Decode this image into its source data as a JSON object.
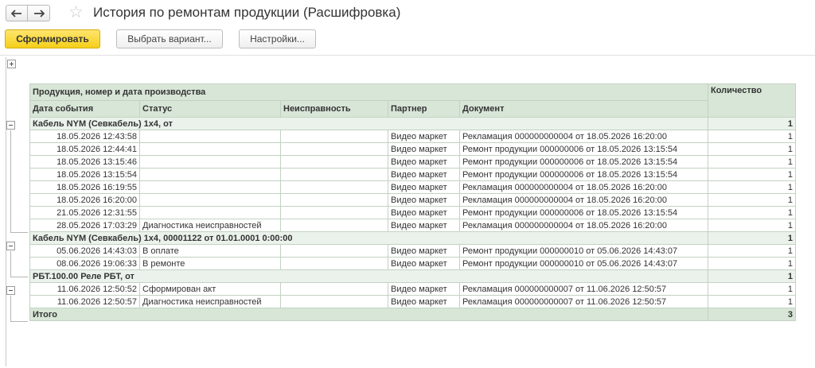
{
  "window": {
    "title": "История по ремонтам продукции (Расшифровка)"
  },
  "toolbar": {
    "generate_label": "Сформировать",
    "variant_label": "Выбрать вариант...",
    "settings_label": "Настройки..."
  },
  "report": {
    "headers": {
      "group_header": "Продукция, номер и дата производства",
      "quantity": "Количество",
      "event_date": "Дата события",
      "status": "Статус",
      "fault": "Неисправность",
      "partner": "Партнер",
      "document": "Документ"
    },
    "groups": [
      {
        "title": "Кабель NYM (Севкабель) 1x4,  от",
        "quantity": "1",
        "rows": [
          {
            "date": "18.05.2026 12:43:58",
            "status": "",
            "fault": "",
            "partner": "Видео маркет",
            "document": "Рекламация 000000000004 от 18.05.2026 16:20:00",
            "qty": "1"
          },
          {
            "date": "18.05.2026 12:44:41",
            "status": "",
            "fault": "",
            "partner": "Видео маркет",
            "document": "Ремонт продукции 000000006 от 18.05.2026 13:15:54",
            "qty": "1"
          },
          {
            "date": "18.05.2026 13:15:46",
            "status": "",
            "fault": "",
            "partner": "Видео маркет",
            "document": "Ремонт продукции 000000006 от 18.05.2026 13:15:54",
            "qty": "1"
          },
          {
            "date": "18.05.2026 13:15:54",
            "status": "",
            "fault": "",
            "partner": "Видео маркет",
            "document": "Ремонт продукции 000000006 от 18.05.2026 13:15:54",
            "qty": "1"
          },
          {
            "date": "18.05.2026 16:19:55",
            "status": "",
            "fault": "",
            "partner": "Видео маркет",
            "document": "Рекламация 000000000004 от 18.05.2026 16:20:00",
            "qty": "1"
          },
          {
            "date": "18.05.2026 16:20:00",
            "status": "",
            "fault": "",
            "partner": "Видео маркет",
            "document": "Рекламация 000000000004 от 18.05.2026 16:20:00",
            "qty": "1"
          },
          {
            "date": "21.05.2026 12:31:55",
            "status": "",
            "fault": "",
            "partner": "Видео маркет",
            "document": "Ремонт продукции 000000006 от 18.05.2026 13:15:54",
            "qty": "1"
          },
          {
            "date": "28.05.2026 17:03:29",
            "status": "Диагностика неисправностей",
            "fault": "",
            "partner": "Видео маркет",
            "document": "Рекламация 000000000004 от 18.05.2026 16:20:00",
            "qty": "1"
          }
        ]
      },
      {
        "title": "Кабель NYM (Севкабель) 1x4, 00001122 от 01.01.0001 0:00:00",
        "quantity": "1",
        "rows": [
          {
            "date": "05.06.2026 14:43:03",
            "status": "В оплате",
            "fault": "",
            "partner": "Видео маркет",
            "document": "Ремонт продукции 000000010 от 05.06.2026 14:43:07",
            "qty": "1"
          },
          {
            "date": "08.06.2026 19:06:33",
            "status": "В ремонте",
            "fault": "",
            "partner": "Видео маркет",
            "document": "Ремонт продукции 000000010 от 05.06.2026 14:43:07",
            "qty": "1"
          }
        ]
      },
      {
        "title": "РБТ.100.00 Реле РБТ,  от",
        "quantity": "1",
        "rows": [
          {
            "date": "11.06.2026 12:50:52",
            "status": "Сформирован акт",
            "fault": "",
            "partner": "Видео маркет",
            "document": "Рекламация 000000000007 от 11.06.2026 12:50:57",
            "qty": "1"
          },
          {
            "date": "11.06.2026 12:50:57",
            "status": "Диагностика неисправностей",
            "fault": "",
            "partner": "Видео маркет",
            "document": "Рекламация 000000000007 от 11.06.2026 12:50:57",
            "qty": "1"
          }
        ]
      }
    ],
    "total": {
      "label": "Итого",
      "quantity": "3"
    }
  },
  "colors": {
    "header_bg": "#d8e6d8",
    "group_bg": "#ebf2eb",
    "primary_button": "#f5cf1a"
  }
}
